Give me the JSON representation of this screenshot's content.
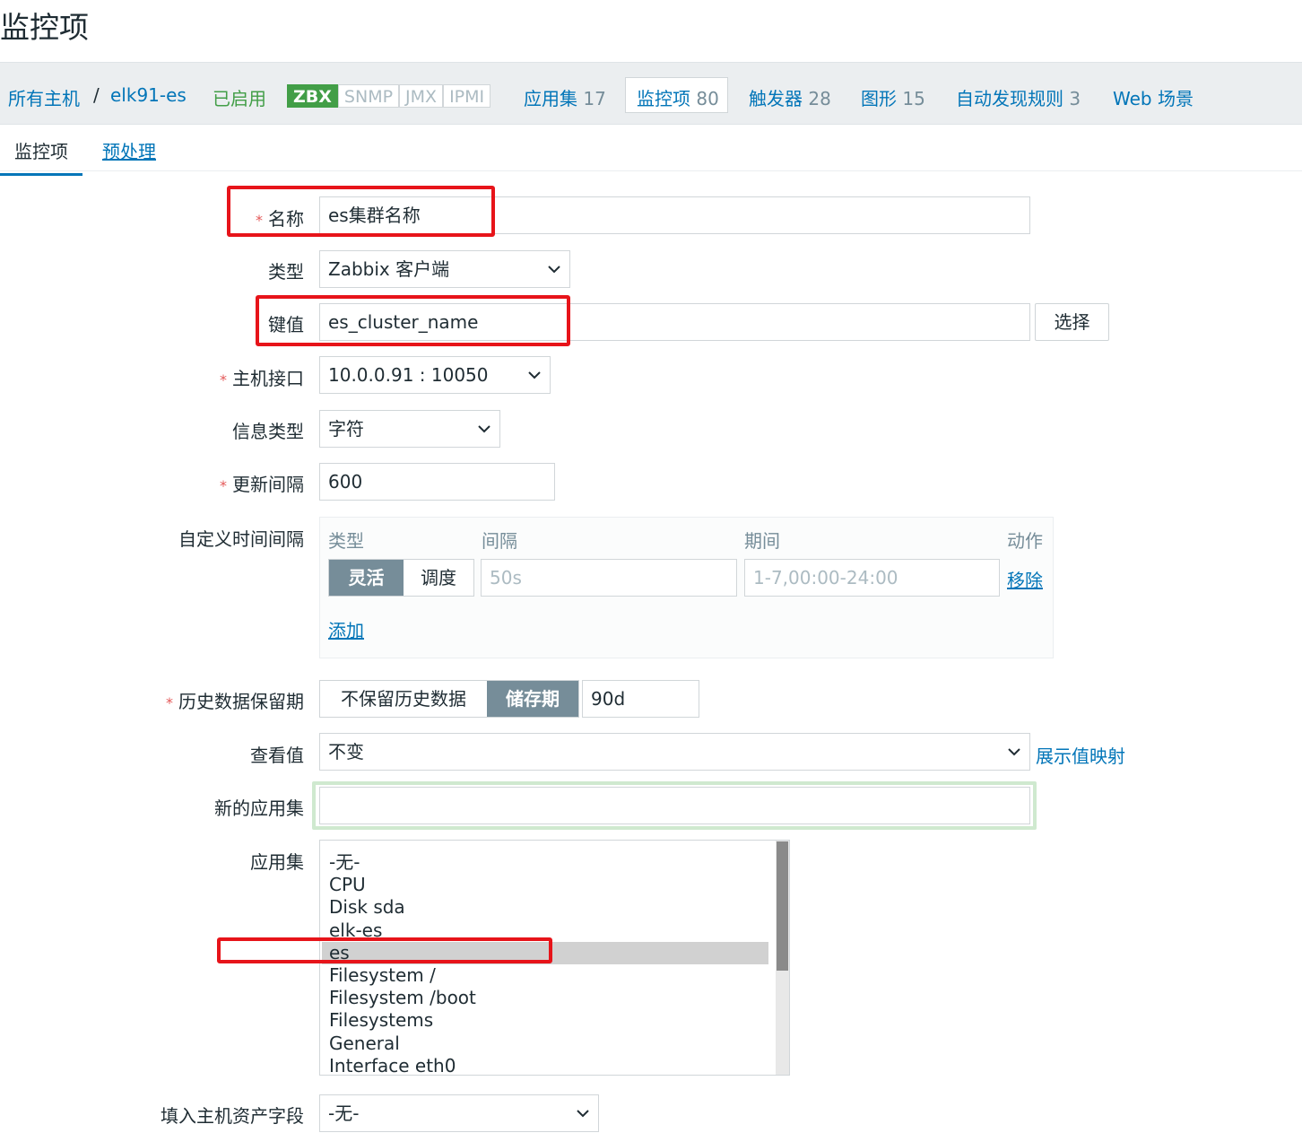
{
  "page_title": "监控项",
  "breadcrumb": {
    "all_hosts": "所有主机",
    "separator": "/",
    "host": "elk91-es"
  },
  "status": "已启用",
  "availability": [
    "ZBX",
    "SNMP",
    "JMX",
    "IPMI"
  ],
  "nav": [
    {
      "label": "应用集",
      "count": "17"
    },
    {
      "label": "监控项",
      "count": "80"
    },
    {
      "label": "触发器",
      "count": "28"
    },
    {
      "label": "图形",
      "count": "15"
    },
    {
      "label": "自动发现规则",
      "count": "3"
    },
    {
      "label": "Web 场景",
      "count": ""
    }
  ],
  "tabs": {
    "item": "监控项",
    "preprocessing": "预处理"
  },
  "form": {
    "name": {
      "label": "名称",
      "value": "es集群名称"
    },
    "type": {
      "label": "类型",
      "value": "Zabbix 客户端"
    },
    "key": {
      "label": "键值",
      "value": "es_cluster_name",
      "select_button": "选择"
    },
    "interface": {
      "label": "主机接口",
      "value": "10.0.0.91 : 10050"
    },
    "value_type": {
      "label": "信息类型",
      "value": "字符"
    },
    "update_interval": {
      "label": "更新间隔",
      "value": "600"
    },
    "custom_intervals": {
      "label": "自定义时间间隔",
      "headers": {
        "type": "类型",
        "interval": "间隔",
        "period": "期间",
        "action": "动作"
      },
      "type_options": [
        "灵活",
        "调度"
      ],
      "interval_placeholder": "50s",
      "period_placeholder": "1-7,00:00-24:00",
      "remove": "移除",
      "add": "添加"
    },
    "history": {
      "label": "历史数据保留期",
      "options": [
        "不保留历史数据",
        "储存期"
      ],
      "value": "90d"
    },
    "valuemap": {
      "label": "查看值",
      "value": "不变",
      "link": "展示值映射"
    },
    "new_application": {
      "label": "新的应用集",
      "value": ""
    },
    "applications": {
      "label": "应用集",
      "items": [
        "-无-",
        "CPU",
        "Disk sda",
        "elk-es",
        "es",
        "Filesystem /",
        "Filesystem /boot",
        "Filesystems",
        "General",
        "Interface eth0"
      ],
      "selected": "es"
    },
    "inventory": {
      "label": "填入主机资产字段",
      "value": "-无-"
    }
  },
  "colors": {
    "link": "#0275b8",
    "enabled": "#429e47",
    "required": "#e45959",
    "annotation": "#e7141a"
  }
}
